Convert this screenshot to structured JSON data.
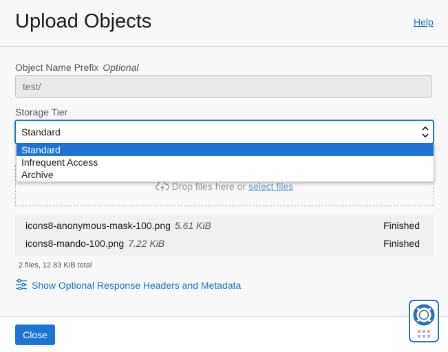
{
  "header": {
    "title": "Upload Objects",
    "help_label": "Help"
  },
  "prefix": {
    "label": "Object Name Prefix",
    "optional": "Optional",
    "value": "test/"
  },
  "storage_tier": {
    "label": "Storage Tier",
    "selected": "Standard",
    "options": [
      "Standard",
      "Infrequent Access",
      "Archive"
    ]
  },
  "dropzone": {
    "text": "Drop files here or",
    "link": "select files"
  },
  "files": [
    {
      "name": "icons8-anonymous-mask-100.png",
      "size": "5.61 KiB",
      "status": "Finished"
    },
    {
      "name": "icons8-mando-100.png",
      "size": "7.22 KiB",
      "status": "Finished"
    }
  ],
  "summary": "2 files, 12.83 KiB total",
  "optional_headers_label": "Show Optional Response Headers and Metadata",
  "footer": {
    "close_label": "Close"
  },
  "colors": {
    "accent": "#1c74d4",
    "link": "#1f6fb5",
    "background": "#f8f8f8"
  },
  "icons": [
    "cloud-upload-icon",
    "sliders-icon",
    "lifebuoy-icon",
    "grip-dots-icon",
    "chevron-updown-icon"
  ]
}
